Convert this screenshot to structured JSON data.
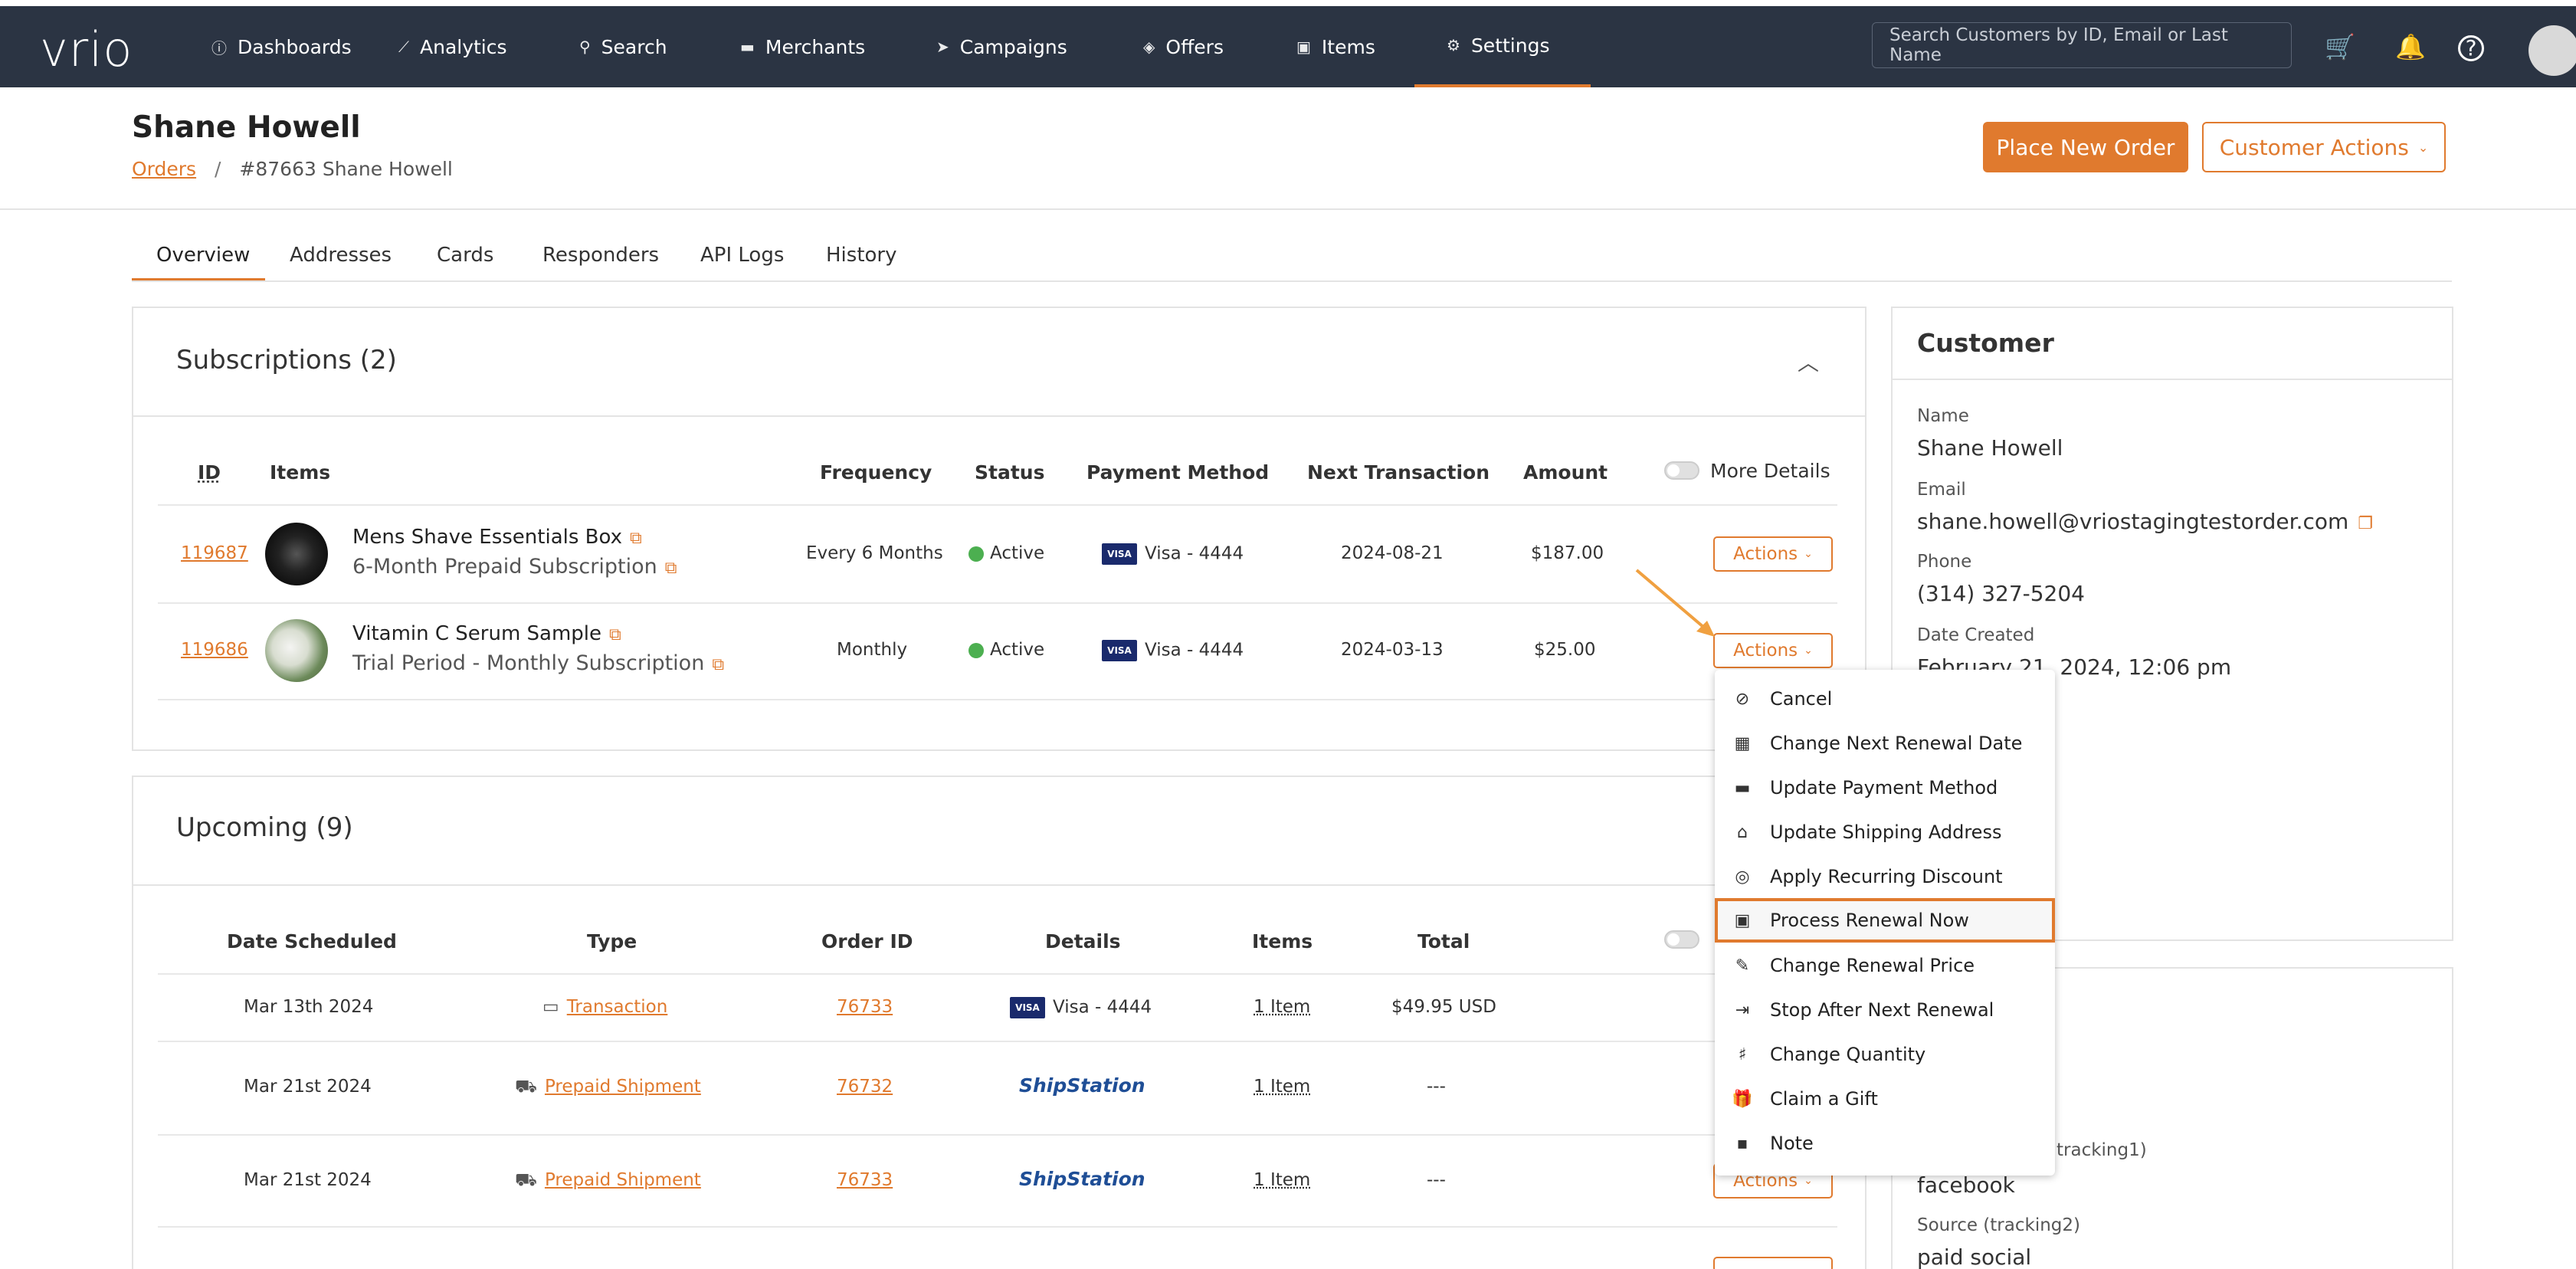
{
  "nav": {
    "logo": "vrio",
    "items": [
      {
        "label": "Dashboards",
        "icon": "dashboard-icon"
      },
      {
        "label": "Analytics",
        "icon": "analytics-icon"
      },
      {
        "label": "Search",
        "icon": "search-icon"
      },
      {
        "label": "Merchants",
        "icon": "merchant-card-icon"
      },
      {
        "label": "Campaigns",
        "icon": "campaign-arrow-icon"
      },
      {
        "label": "Offers",
        "icon": "offers-layers-icon"
      },
      {
        "label": "Items",
        "icon": "items-box-icon"
      },
      {
        "label": "Settings",
        "icon": "settings-gears-icon"
      }
    ],
    "active": "Settings",
    "search_placeholder": "Search Customers by ID, Email or Last Name"
  },
  "header": {
    "title": "Shane Howell",
    "breadcrumb_link": "Orders",
    "breadcrumb_sep": "/",
    "breadcrumb_current": "#87663 Shane Howell",
    "place_order": "Place New Order",
    "customer_actions": "Customer Actions"
  },
  "tabs": [
    "Overview",
    "Addresses",
    "Cards",
    "Responders",
    "API Logs",
    "History"
  ],
  "subscriptions": {
    "title": "Subscriptions (2)",
    "headers": {
      "id": "ID",
      "items": "Items",
      "frequency": "Frequency",
      "status": "Status",
      "payment": "Payment Method",
      "next": "Next Transaction",
      "amount": "Amount",
      "more": "More Details"
    },
    "rows": [
      {
        "id": "119687",
        "name": "Mens Shave Essentials Box",
        "sub": "6-Month Prepaid Subscription",
        "frequency": "Every 6 Months",
        "status": "Active",
        "payment": "Visa - 4444",
        "next": "2024-08-21",
        "amount": "$187.00",
        "action": "Actions"
      },
      {
        "id": "119686",
        "name": "Vitamin C Serum Sample",
        "sub": "Trial Period - Monthly Subscription",
        "frequency": "Monthly",
        "status": "Active",
        "payment": "Visa - 4444",
        "next": "2024-03-13",
        "amount": "$25.00",
        "action": "Actions"
      }
    ]
  },
  "upcoming": {
    "title": "Upcoming (9)",
    "headers": {
      "date": "Date Scheduled",
      "type": "Type",
      "order": "Order ID",
      "details": "Details",
      "items": "Items",
      "total": "Total"
    },
    "rows": [
      {
        "date": "Mar 13th 2024",
        "type": "Transaction",
        "order": "76733",
        "details": "Visa - 4444",
        "items": "1 Item",
        "total": "$49.95 USD"
      },
      {
        "date": "Mar 21st 2024",
        "type": "Prepaid Shipment",
        "order": "76732",
        "details": "ShipStation",
        "items": "1 Item",
        "total": "---"
      },
      {
        "date": "Mar 21st 2024",
        "type": "Prepaid Shipment",
        "order": "76733",
        "details": "ShipStation",
        "items": "1 Item",
        "total": "---",
        "action": "Actions"
      }
    ]
  },
  "dropdown": {
    "items": [
      {
        "label": "Cancel",
        "icon": "cancel-circle-icon"
      },
      {
        "label": "Change Next Renewal Date",
        "icon": "calendar-icon"
      },
      {
        "label": "Update Payment Method",
        "icon": "credit-card-icon"
      },
      {
        "label": "Update Shipping Address",
        "icon": "home-icon"
      },
      {
        "label": "Apply Recurring Discount",
        "icon": "discount-icon"
      },
      {
        "label": "Process Renewal Now",
        "icon": "money-icon"
      },
      {
        "label": "Change Renewal Price",
        "icon": "pencil-icon"
      },
      {
        "label": "Stop After Next Renewal",
        "icon": "arrow-stop-icon"
      },
      {
        "label": "Change Quantity",
        "icon": "quantity-icon"
      },
      {
        "label": "Claim a Gift",
        "icon": "gift-icon"
      },
      {
        "label": "Note",
        "icon": "note-icon"
      }
    ],
    "highlighted": "Process Renewal Now"
  },
  "customer": {
    "title": "Customer",
    "name_label": "Name",
    "name": "Shane Howell",
    "email_label": "Email",
    "email": "shane.howell@vriostagingtestorder.com",
    "phone_label": "Phone",
    "phone": "(314) 327-5204",
    "created_label": "Date Created",
    "created": "February 21, 2024, 12:06 pm",
    "tracking1_label": "tracking1)",
    "tracking1": "facebook",
    "tracking2_label": "Source (tracking2)",
    "tracking2": "paid social"
  },
  "colors": {
    "accent": "#e07a2e",
    "nav_bg": "#2b3443",
    "active_status": "#4caf50"
  }
}
